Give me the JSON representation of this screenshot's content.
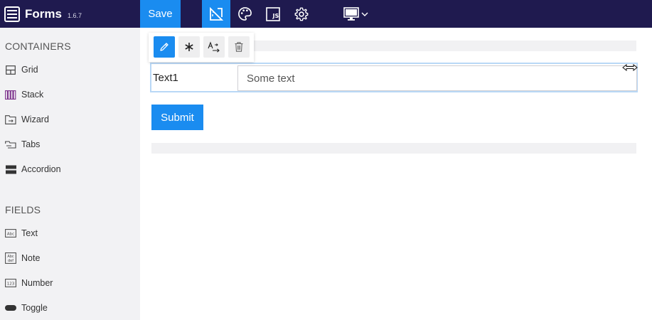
{
  "header": {
    "app_title": "Forms",
    "version": "1.6.7",
    "save_label": "Save",
    "js_label": "JS",
    "colors": {
      "bar": "#1f1a4f",
      "accent": "#1a8cf0"
    }
  },
  "sidebar": {
    "containers_title": "CONTAINERS",
    "containers": [
      {
        "label": "Grid",
        "icon": "grid-icon"
      },
      {
        "label": "Stack",
        "icon": "stack-icon"
      },
      {
        "label": "Wizard",
        "icon": "wizard-icon"
      },
      {
        "label": "Tabs",
        "icon": "tabs-icon"
      },
      {
        "label": "Accordion",
        "icon": "accordion-icon"
      }
    ],
    "fields_title": "FIELDS",
    "fields": [
      {
        "label": "Text",
        "icon": "text-field-icon",
        "glyph": "Abc"
      },
      {
        "label": "Note",
        "icon": "note-field-icon",
        "glyph": "Abc def"
      },
      {
        "label": "Number",
        "icon": "number-field-icon",
        "glyph": "123"
      },
      {
        "label": "Toggle",
        "icon": "toggle-field-icon"
      }
    ]
  },
  "canvas": {
    "field_label": "Text1",
    "field_placeholder": "Some text",
    "submit_label": "Submit"
  },
  "float_toolbar": {
    "icons": [
      "pencil-icon",
      "asterisk-icon",
      "rename-icon",
      "trash-icon"
    ]
  }
}
